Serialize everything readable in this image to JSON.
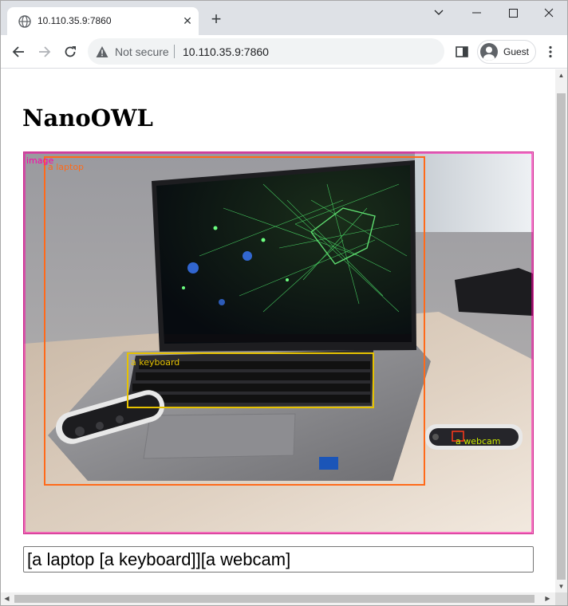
{
  "browser": {
    "tab": {
      "title": "10.110.35.9:7860"
    },
    "security_label": "Not secure",
    "url": "10.110.35.9:7860",
    "profile_name": "Guest"
  },
  "page": {
    "title": "NanoOWL",
    "detections": [
      {
        "label": "image",
        "color": "#ff00aa"
      },
      {
        "label": "a laptop",
        "color": "#ff6a1a"
      },
      {
        "label": "a keyboard",
        "color": "#e6c200"
      },
      {
        "label": "a webcam",
        "color": "#c8e600"
      }
    ],
    "prompt_value": "[a laptop [a keyboard]][a webcam]"
  },
  "colors": {
    "frame_border": "#cc2a8c",
    "tab_strip": "#dee1e6",
    "omnibox_bg": "#f1f3f4"
  }
}
